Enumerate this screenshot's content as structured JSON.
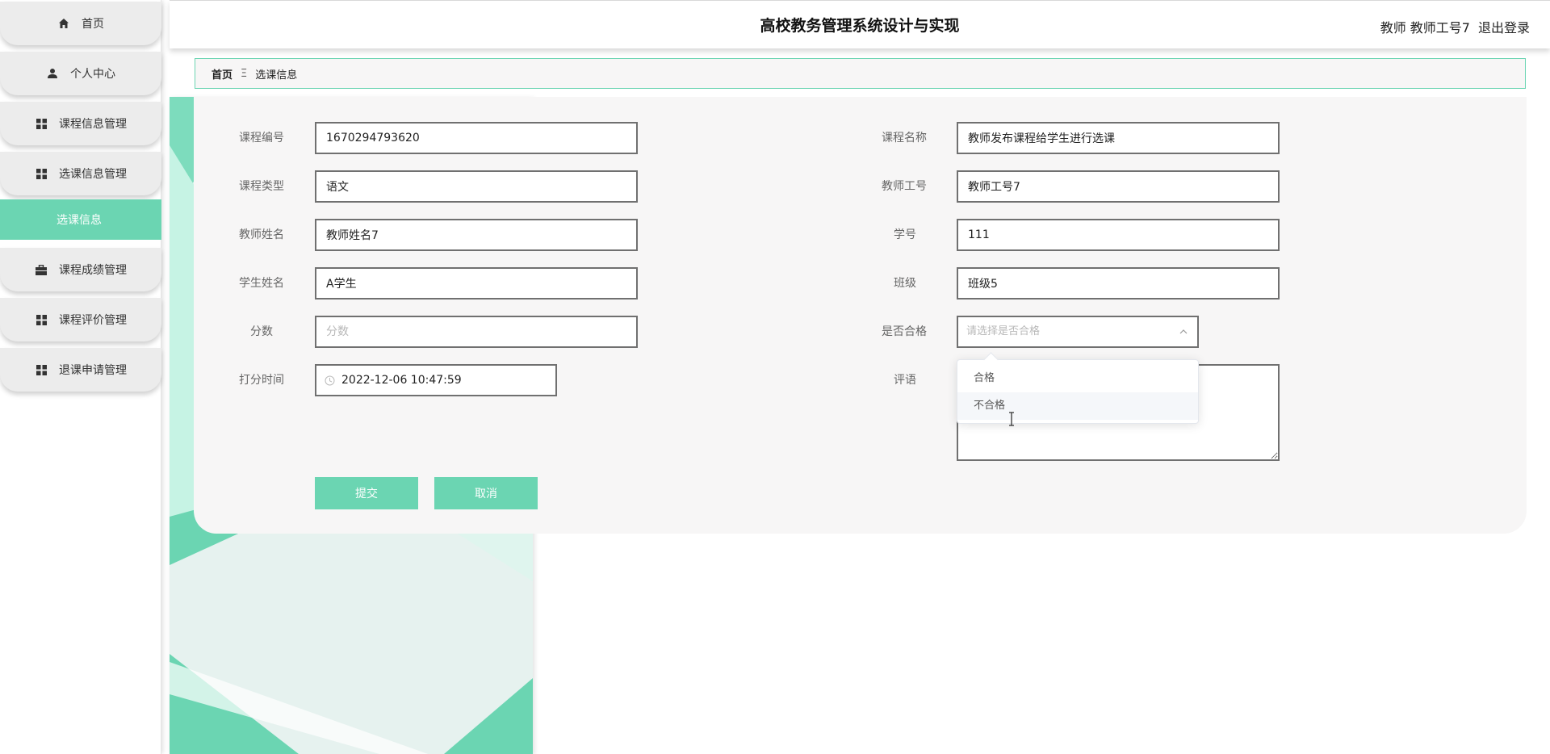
{
  "header": {
    "title": "高校教务管理系统设计与实现",
    "user": "教师 教师工号7",
    "logout": "退出登录"
  },
  "sidebar": {
    "items": [
      {
        "label": "首页",
        "icon": "home-icon"
      },
      {
        "label": "个人中心",
        "icon": "user-icon"
      },
      {
        "label": "课程信息管理",
        "icon": "grid-icon"
      },
      {
        "label": "选课信息管理",
        "icon": "grid-icon"
      },
      {
        "label": "课程成绩管理",
        "icon": "briefcase-icon"
      },
      {
        "label": "课程评价管理",
        "icon": "grid-icon"
      },
      {
        "label": "退课申请管理",
        "icon": "grid-icon"
      }
    ],
    "submenu_active": "选课信息"
  },
  "breadcrumb": {
    "home": "首页",
    "separator": "Ξ",
    "current": "选课信息"
  },
  "form": {
    "course_id": {
      "label": "课程编号",
      "value": "1670294793620"
    },
    "course_name": {
      "label": "课程名称",
      "value": "教师发布课程给学生进行选课"
    },
    "course_type": {
      "label": "课程类型",
      "value": "语文"
    },
    "teacher_id": {
      "label": "教师工号",
      "value": "教师工号7"
    },
    "teacher_name": {
      "label": "教师姓名",
      "value": "教师姓名7"
    },
    "student_id": {
      "label": "学号",
      "value": "111"
    },
    "student_name": {
      "label": "学生姓名",
      "value": "A学生"
    },
    "class_name": {
      "label": "班级",
      "value": "班级5"
    },
    "score": {
      "label": "分数",
      "placeholder": "分数"
    },
    "pass": {
      "label": "是否合格",
      "placeholder": "请选择是否合格",
      "options": [
        "合格",
        "不合格"
      ]
    },
    "score_time": {
      "label": "打分时间",
      "value": "2022-12-06 10:47:59"
    },
    "comment": {
      "label": "评语"
    },
    "submit": "提交",
    "cancel": "取消"
  },
  "colors": {
    "accent": "#6bd5b2",
    "panel": "#f7f6f6",
    "menu": "#ececec"
  }
}
